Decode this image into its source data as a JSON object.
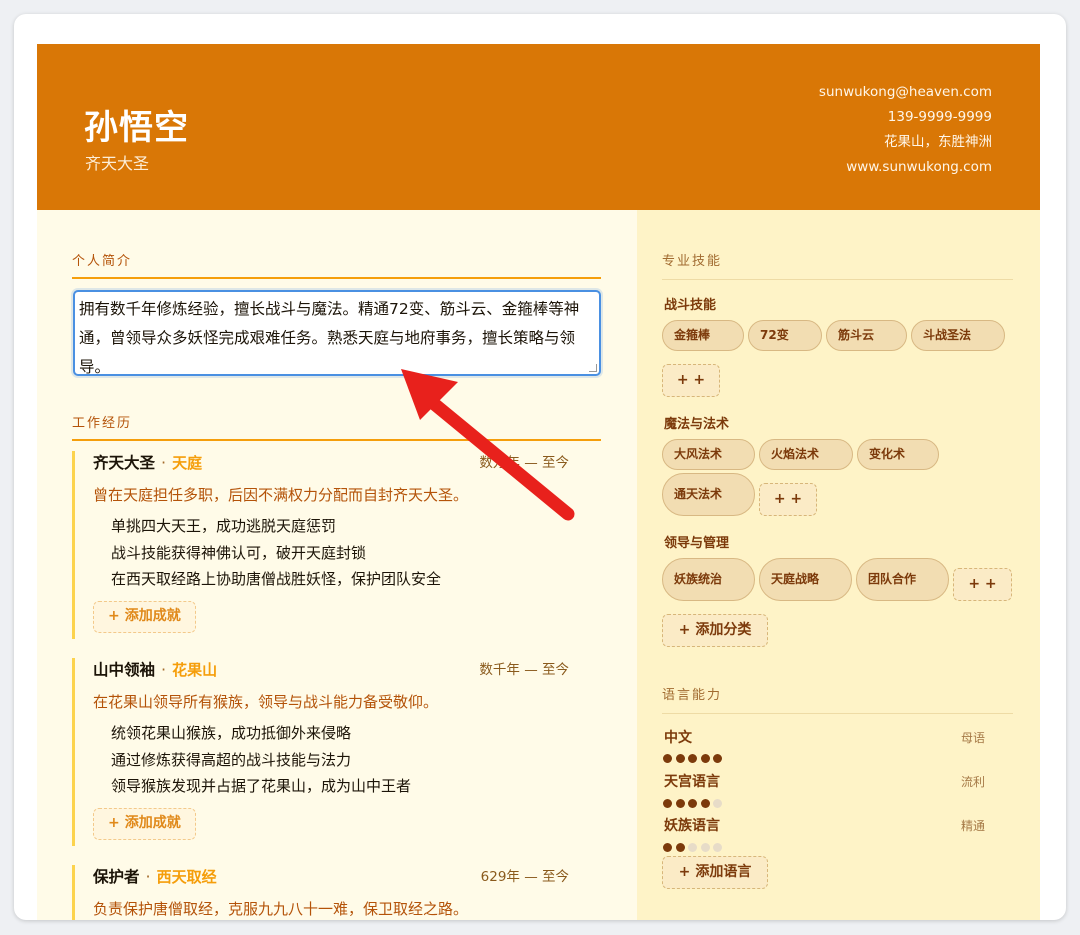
{
  "header": {
    "name": "孙悟空",
    "title": "齐天大圣",
    "email": "sunwukong@heaven.com",
    "phone": "139-9999-9999",
    "location": "花果山，东胜神洲",
    "website": "www.sunwukong.com"
  },
  "sections": {
    "summary": "个人简介",
    "experience": "工作经历",
    "skills": "专业技能",
    "languages": "语言能力"
  },
  "summary_text": "拥有数千年修炼经验，擅长战斗与魔法。精通72变、筋斗云、金箍棒等神通，曾领导众多妖怪完成艰难任务。熟悉天庭与地府事务，擅长策略与领导。",
  "jobs": [
    {
      "role": "齐天大圣",
      "org": "天庭",
      "date": "数万年 — 至今",
      "desc": "曾在天庭担任多职，后因不满权力分配而自封齐天大圣。",
      "achievements": [
        "单挑四大天王，成功逃脱天庭惩罚",
        "战斗技能获得神佛认可，破开天庭封锁",
        "在西天取经路上协助唐僧战胜妖怪，保护团队安全"
      ],
      "add_label": "添加成就"
    },
    {
      "role": "山中领袖",
      "org": "花果山",
      "date": "数千年 — 至今",
      "desc": "在花果山领导所有猴族，领导与战斗能力备受敬仰。",
      "achievements": [
        "统领花果山猴族，成功抵御外来侵略",
        "通过修炼获得高超的战斗技能与法力",
        "领导猴族发现并占据了花果山，成为山中王者"
      ],
      "add_label": "添加成就"
    },
    {
      "role": "保护者",
      "org": "西天取经",
      "date": "629年 — 至今",
      "desc": "负责保护唐僧取经，克服九九八十一难，保卫取经之路。"
    }
  ],
  "skills": {
    "categories": [
      {
        "name": "战斗技能",
        "items": [
          "金箍棒",
          "72变",
          "筋斗云",
          "斗战圣法"
        ]
      },
      {
        "name": "魔法与法术",
        "items": [
          "大风法术",
          "火焰法术",
          "变化术",
          "通天法术"
        ]
      },
      {
        "name": "领导与管理",
        "items": [
          "妖族统治",
          "天庭战略",
          "团队合作"
        ]
      }
    ],
    "add_item": "+ +",
    "add_category": "添加分类"
  },
  "languages": {
    "items": [
      {
        "name": "中文",
        "level": "母语",
        "rating": 5
      },
      {
        "name": "天宫语言",
        "level": "流利",
        "rating": 4
      },
      {
        "name": "妖族语言",
        "level": "精通",
        "rating": 2
      }
    ],
    "add_label": "添加语言"
  },
  "colors": {
    "accent": "#d97706",
    "focus": "#4a90e2",
    "annotation_arrow": "#e8211c"
  }
}
